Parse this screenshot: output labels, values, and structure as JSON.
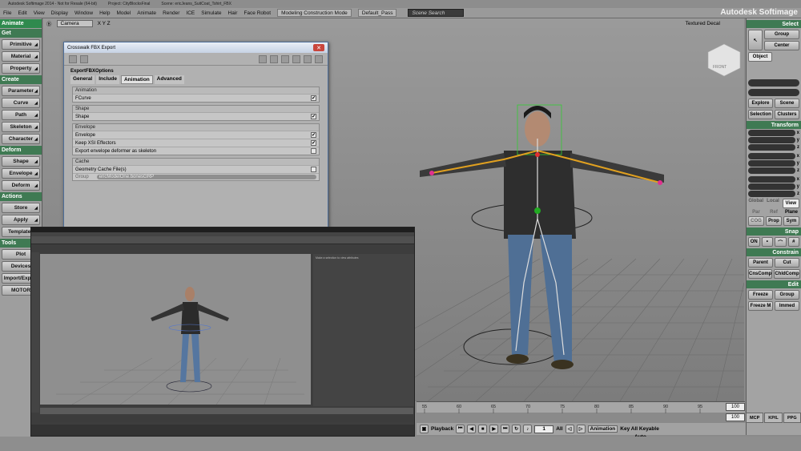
{
  "window": {
    "title": "Autodesk Softimage 2014  - Not for Resale (64-bit)",
    "project": "Project: CityBlocksFinal",
    "scene": "Scene: ericJeans_SuitCoat_Tshirt_FBX",
    "brand": "Autodesk Softimage"
  },
  "menu": {
    "items": [
      "File",
      "Edit",
      "View",
      "Display",
      "Window",
      "Help",
      "Model",
      "Animate",
      "Render",
      "ICE",
      "Simulate",
      "Hair",
      "Face Robot"
    ],
    "mode": "Modeling Construction Mode",
    "pass": "Default_Pass",
    "search_placeholder": "Scene Search"
  },
  "left_panel": {
    "mode": "Animate",
    "sections": [
      {
        "header": "Get",
        "buttons": [
          "Primitive",
          "Material",
          "Property"
        ]
      },
      {
        "header": "Create",
        "buttons": [
          "Parameter",
          "Curve",
          "Path",
          "Skeleton",
          "Character"
        ]
      },
      {
        "header": "Deform",
        "buttons": [
          "Shape",
          "Envelope",
          "Deform"
        ]
      },
      {
        "header": "Actions",
        "buttons": [
          "Store",
          "Apply",
          "Templates"
        ]
      },
      {
        "header": "Tools",
        "buttons": [
          "Plot",
          "Devices",
          "Import/Export",
          "MOTOR"
        ]
      }
    ]
  },
  "viewport": {
    "camera": "Camera",
    "axes": "X Y Z",
    "display": "Textured Decal",
    "cube_label": "FRONT"
  },
  "dialog": {
    "title": "Crosswalk FBX Export",
    "section": "ExportFBXOptions",
    "tabs": [
      "General",
      "Include",
      "Animation",
      "Advanced"
    ],
    "groups": {
      "animation": {
        "header": "Animation",
        "rows": [
          {
            "label": "FCurve",
            "checked": true
          }
        ]
      },
      "shape": {
        "header": "Shape",
        "rows": [
          {
            "label": "Shape",
            "checked": true
          }
        ]
      },
      "envelope": {
        "header": "Envelope",
        "rows": [
          {
            "label": "Envelope",
            "checked": true
          },
          {
            "label": "Keep XSI Effectors",
            "checked": true
          },
          {
            "label": "Export envelope deformer as skeleton",
            "checked": false
          }
        ]
      },
      "cache": {
        "header": "Cache",
        "rows": [
          {
            "label": "Geometry Cache File(s)",
            "checked": false
          }
        ],
        "group_label": "Group",
        "group_value": "ericModelOne.bonesGRP"
      }
    }
  },
  "right_panel": {
    "select_header": "Select",
    "group": "Group",
    "center": "Center",
    "object": "Object",
    "explore": "Explore",
    "scene": "Scene",
    "selection": "Selection",
    "clusters": "Clusters",
    "transform_header": "Transform",
    "axes": [
      "x",
      "y",
      "z"
    ],
    "global": "Global",
    "local": "Local",
    "view": "View",
    "par": "Par",
    "ref": "Ref",
    "plane": "Plane",
    "cog": "COG",
    "prop": "Prop",
    "sym": "Sym",
    "snap_header": "Snap",
    "on": "ON",
    "constrain_header": "Constrain",
    "parent": "Parent",
    "cut": "Cut",
    "cnscomp": "CnsComp",
    "childcomp": "ChldComp",
    "edit_header": "Edit",
    "freeze": "Freeze",
    "group2": "Group",
    "freeze_m": "Freeze M",
    "immed": "Immed",
    "tabs": [
      "MCP",
      "KP/L",
      "PPG"
    ]
  },
  "timeline": {
    "ticks": [
      "55",
      "60",
      "65",
      "70",
      "75",
      "80",
      "85",
      "90",
      "95"
    ],
    "end_frame": "100",
    "end_frame2": "100"
  },
  "playback": {
    "label": "Playback",
    "frame": "1",
    "all": "All",
    "animation": "Animation",
    "auto": "Auto",
    "key": "Key All Keyable"
  },
  "maya": {
    "attr_text": "Make a selection to view attributes"
  }
}
